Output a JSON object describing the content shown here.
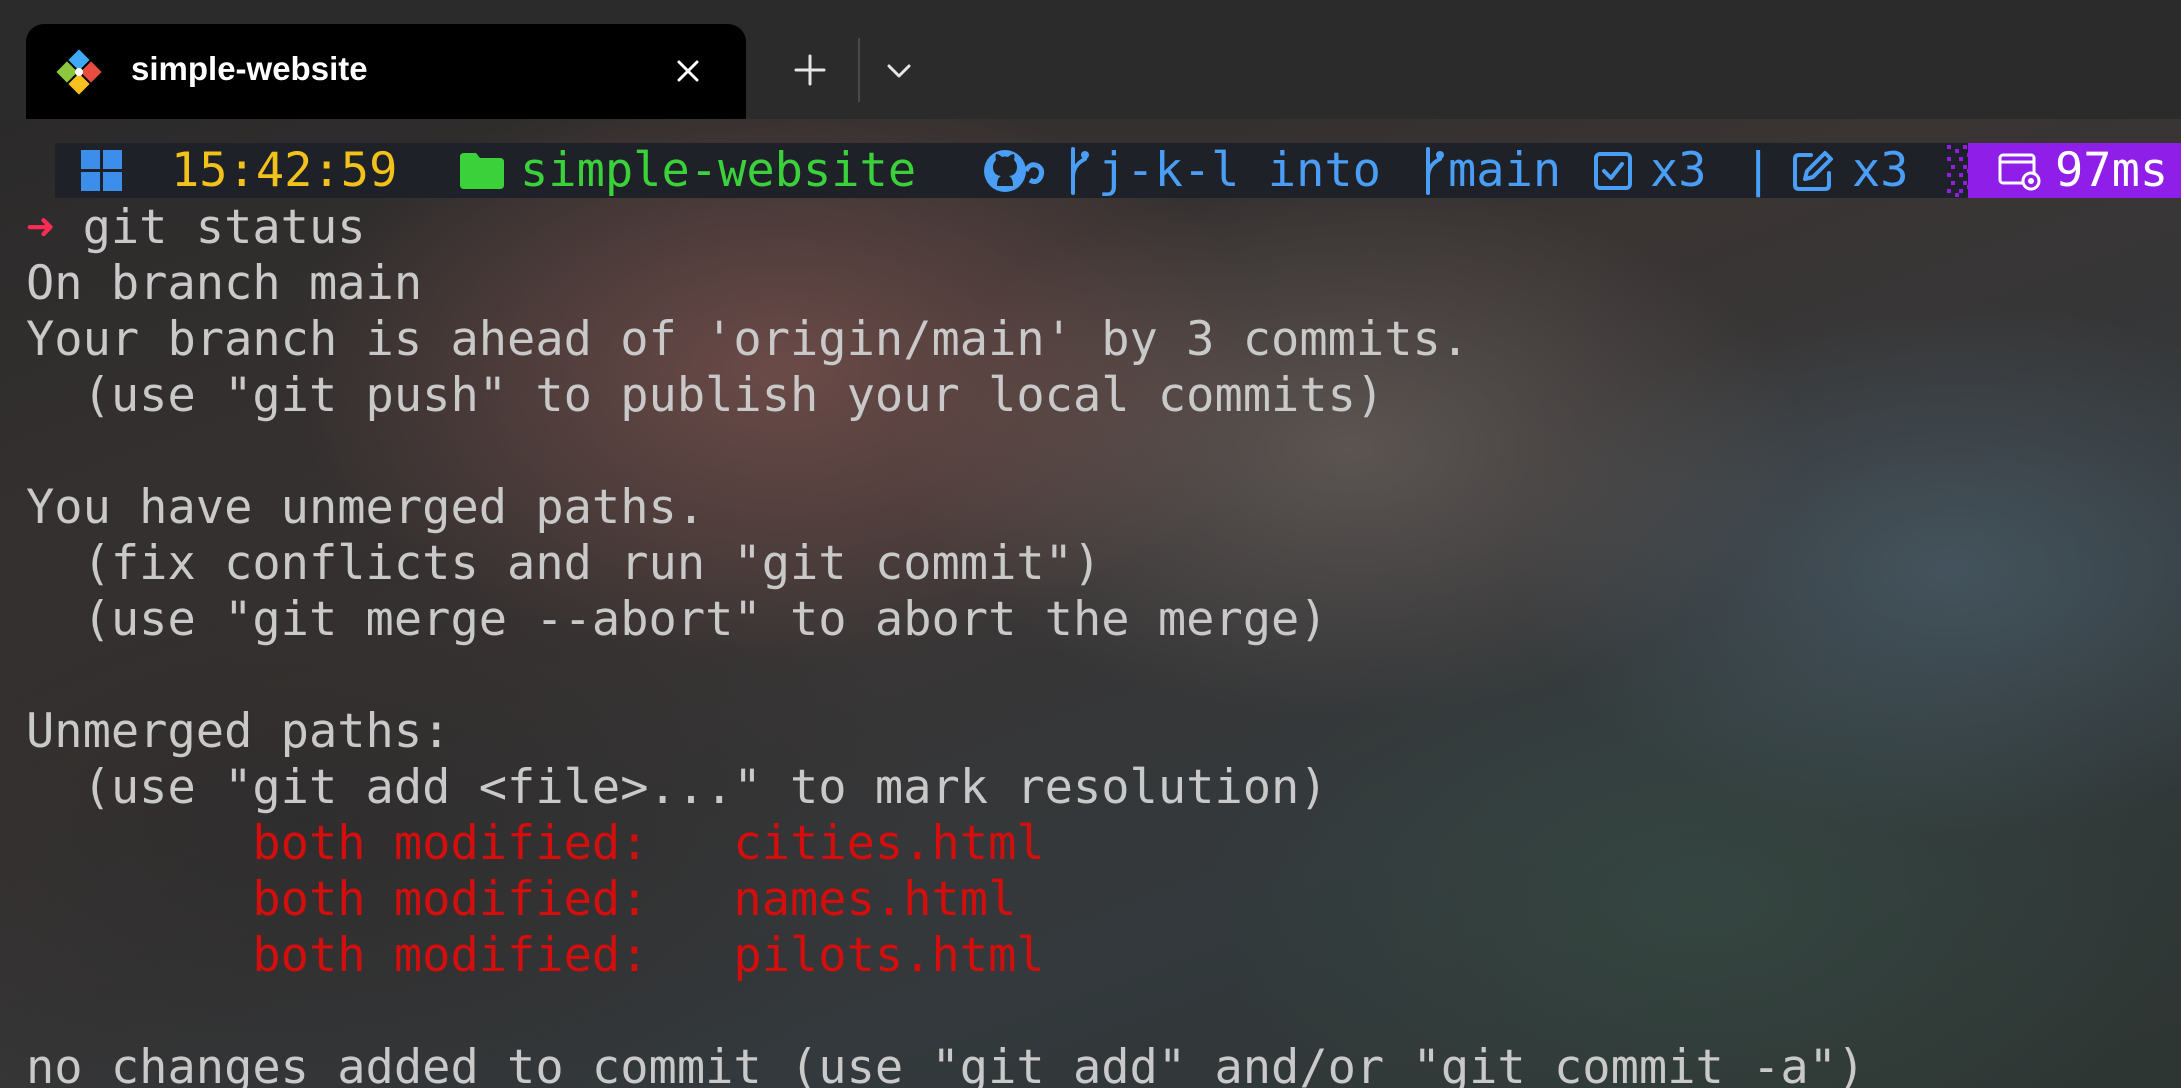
{
  "tab": {
    "title": "simple-website",
    "icon": "git-diamond-icon"
  },
  "tabbar": {
    "close_icon": "close-icon",
    "new_tab_icon": "plus-icon",
    "dropdown_icon": "chevron-down-icon"
  },
  "prompt": {
    "time": "15:42:59",
    "directory": "simple-website",
    "merge_text": "j-k-l into",
    "branch": "main",
    "staged": "x3",
    "separator": "|",
    "modified": "x3",
    "exec_time": "97ms",
    "timer_bg_color": "#8e1ee8"
  },
  "terminal": {
    "prompt_arrow": "➜",
    "command": " git status",
    "lines": [
      "On branch main",
      "Your branch is ahead of 'origin/main' by 3 commits.",
      "  (use \"git push\" to publish your local commits)",
      "",
      "You have unmerged paths.",
      "  (fix conflicts and run \"git commit\")",
      "  (use \"git merge --abort\" to abort the merge)",
      "",
      "Unmerged paths:",
      "  (use \"git add <file>...\" to mark resolution)"
    ],
    "conflicts": [
      "        both modified:   cities.html",
      "        both modified:   names.html",
      "        both modified:   pilots.html"
    ],
    "last_line": "no changes added to commit (use \"git add\" and/or \"git commit -a\")"
  },
  "colors": {
    "text": "#c9c9c9",
    "conflict": "#d40d0d",
    "arrow": "#ff2b55",
    "time": "#f2c21a",
    "directory": "#3bd13b",
    "git": "#4a9ef5"
  }
}
